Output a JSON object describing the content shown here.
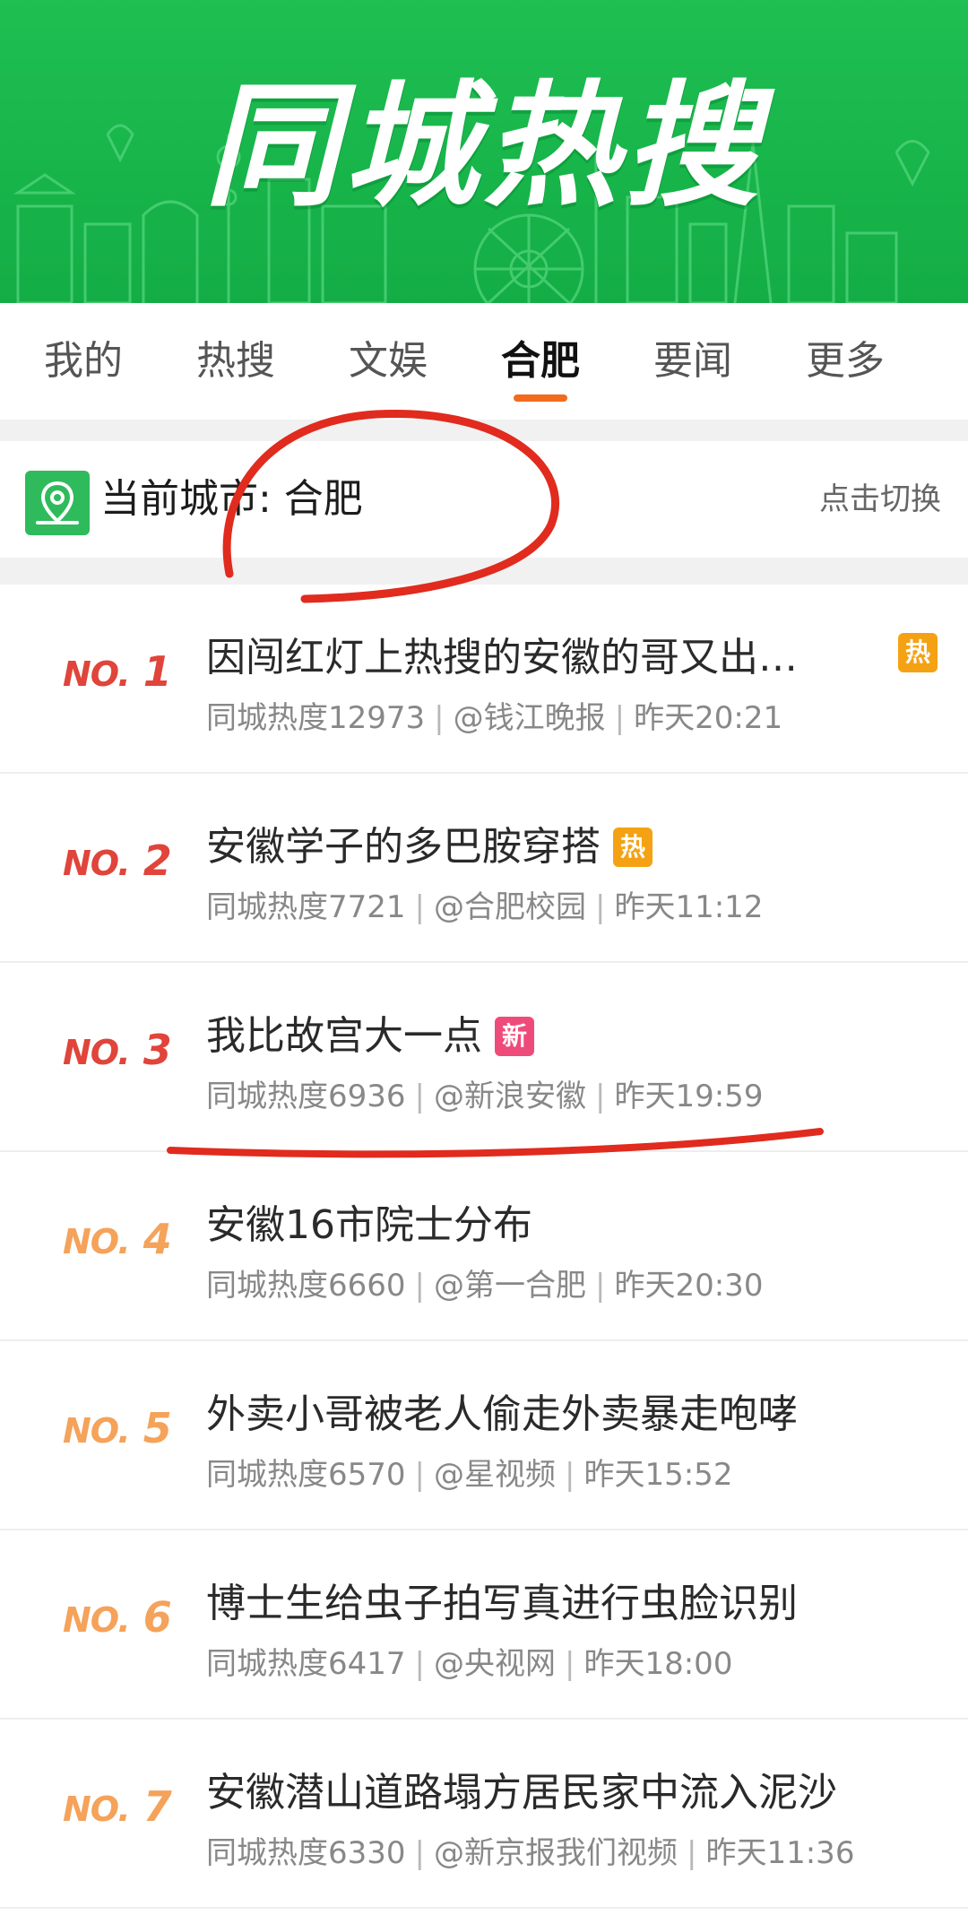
{
  "banner": {
    "title": "同城热搜"
  },
  "tabs": [
    {
      "label": "我的",
      "active": false
    },
    {
      "label": "热搜",
      "active": false
    },
    {
      "label": "文娱",
      "active": false
    },
    {
      "label": "合肥",
      "active": true
    },
    {
      "label": "要闻",
      "active": false
    },
    {
      "label": "更多",
      "active": false
    }
  ],
  "city": {
    "label": "当前城市: 合肥",
    "switch_label": "点击切换",
    "icon": "location-pin-icon"
  },
  "list": [
    {
      "rank_prefix": "NO.",
      "rank": "1",
      "title": "因闯红灯上热搜的安徽的哥又出…",
      "badge": "热",
      "heat": "同城热度12973",
      "source": "@钱江晚报",
      "time": "昨天20:21"
    },
    {
      "rank_prefix": "NO.",
      "rank": "2",
      "title": "安徽学子的多巴胺穿搭",
      "badge": "热",
      "heat": "同城热度7721",
      "source": "@合肥校园",
      "time": "昨天11:12"
    },
    {
      "rank_prefix": "NO.",
      "rank": "3",
      "title": "我比故宫大一点",
      "badge": "新",
      "heat": "同城热度6936",
      "source": "@新浪安徽",
      "time": "昨天19:59"
    },
    {
      "rank_prefix": "NO.",
      "rank": "4",
      "title": "安徽16市院士分布",
      "badge": "",
      "heat": "同城热度6660",
      "source": "@第一合肥",
      "time": "昨天20:30"
    },
    {
      "rank_prefix": "NO.",
      "rank": "5",
      "title": "外卖小哥被老人偷走外卖暴走咆哮",
      "badge": "",
      "heat": "同城热度6570",
      "source": "@星视频",
      "time": "昨天15:52"
    },
    {
      "rank_prefix": "NO.",
      "rank": "6",
      "title": "博士生给虫子拍写真进行虫脸识别",
      "badge": "",
      "heat": "同城热度6417",
      "source": "@央视网",
      "time": "昨天18:00"
    },
    {
      "rank_prefix": "NO.",
      "rank": "7",
      "title": "安徽潜山道路塌方居民家中流入泥沙",
      "badge": "",
      "heat": "同城热度6330",
      "source": "@新京报我们视频",
      "time": "昨天11:36"
    }
  ],
  "colors": {
    "banner_green": "#17b44a",
    "tab_underline": "#f26b1d",
    "rank_top": "#e0443a",
    "rank_low": "#f5a25a",
    "badge_hot": "#f4a214",
    "badge_new": "#ef4b7a",
    "annotation_red": "#e02b1e"
  }
}
